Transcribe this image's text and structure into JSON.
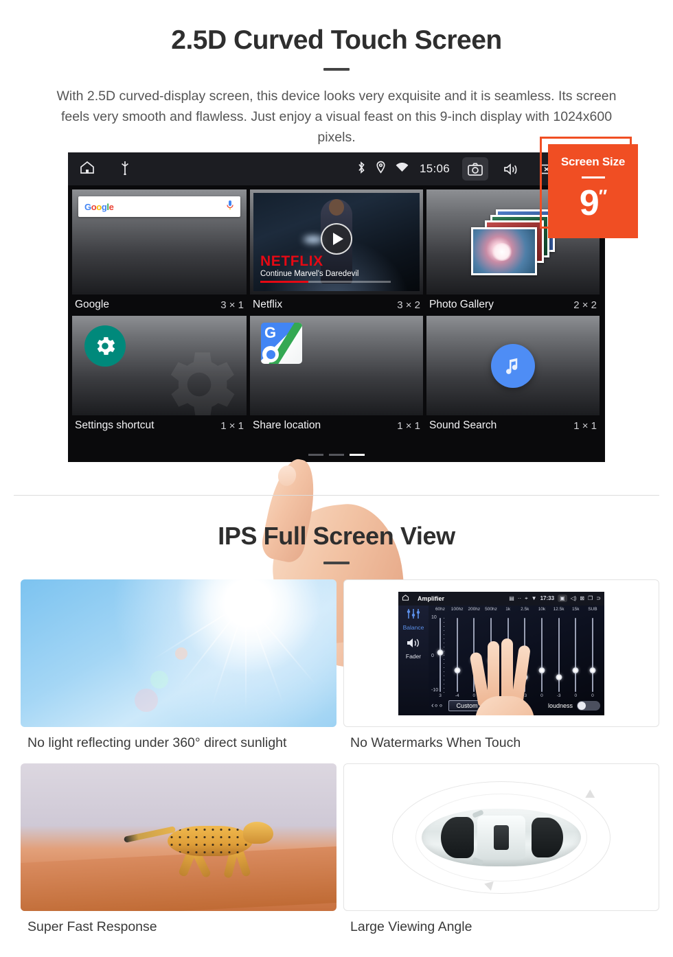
{
  "section1": {
    "title": "2.5D Curved Touch Screen",
    "description": "With 2.5D curved-display screen, this device looks very exquisite and it is seamless. Its screen feels very smooth and flawless. Just enjoy a visual feast on this 9-inch display with 1024x600 pixels."
  },
  "badge": {
    "title": "Screen Size",
    "value": "9",
    "unit": "″",
    "color": "#F04E23"
  },
  "device": {
    "statusbar": {
      "home_icon": "home-icon",
      "usb_icon": "usb-icon",
      "bluetooth_icon": "bluetooth-icon",
      "location_icon": "location-pin-icon",
      "wifi_icon": "wifi-icon",
      "clock": "15:06",
      "screenshot_icon": "camera-icon",
      "volume_icon": "volume-icon",
      "close_icon": "close-box-icon",
      "recents_icon": "recents-icon"
    },
    "widgets": [
      {
        "name": "Google",
        "size": "3 × 1",
        "icon": "google-search-widget",
        "search_placeholder": "",
        "mic_icon": "microphone-icon",
        "logo_letters": [
          "G",
          "o",
          "o",
          "g",
          "l",
          "e"
        ]
      },
      {
        "name": "Netflix",
        "size": "3 × 2",
        "icon": "netflix-widget",
        "brand": "NETFLIX",
        "subtitle": "Continue Marvel's Daredevil",
        "play_icon": "play-icon"
      },
      {
        "name": "Photo Gallery",
        "size": "2 × 2",
        "icon": "photo-gallery-widget"
      },
      {
        "name": "Settings shortcut",
        "size": "1 × 1",
        "icon": "gear-icon"
      },
      {
        "name": "Share location",
        "size": "1 × 1",
        "icon": "google-maps-icon"
      },
      {
        "name": "Sound Search",
        "size": "1 × 1",
        "icon": "music-note-icon"
      }
    ],
    "page_dots": 3,
    "active_dot": 3
  },
  "section2": {
    "title": "IPS Full Screen View",
    "items": [
      {
        "caption": "No light reflecting under 360° direct sunlight",
        "media": "blue-sky-sunlight-photo"
      },
      {
        "caption": "No Watermarks When Touch",
        "media": "amplifier-equalizer-screenshot"
      },
      {
        "caption": "Super Fast Response",
        "media": "running-cheetah-photo"
      },
      {
        "caption": "Large Viewing Angle",
        "media": "car-top-view-illustration"
      }
    ]
  },
  "amplifier": {
    "home_icon": "home-icon",
    "title": "Amplifier",
    "gallery_icon": "gallery-icon",
    "dots_icon": "more-icon",
    "location_icon": "location-pin-icon",
    "wifi_icon": "wifi-icon",
    "time": "17:33",
    "camera_icon": "camera-icon",
    "volume_icon": "volume-icon",
    "close_icon": "close-box-icon",
    "recents_icon": "recents-icon",
    "back_icon": "back-icon",
    "sidebar": [
      {
        "icon": "equalizer-icon",
        "label": "Balance"
      },
      {
        "icon": "speaker-icon",
        "label": "Fader"
      }
    ],
    "axis_labels": [
      "10",
      "0",
      "-10"
    ],
    "bands": [
      "60hz",
      "100hz",
      "200hz",
      "500hz",
      "1k",
      "2.5k",
      "10k",
      "12.5k",
      "15k",
      "SUB"
    ],
    "values": [
      "3",
      "-4",
      "0",
      "0",
      "0",
      "-3",
      "0",
      "-3",
      "0",
      "0"
    ],
    "preset_button": "Custom",
    "prev_icon": "prev-icon",
    "loudness_label": "loudness",
    "loudness_on": false
  }
}
